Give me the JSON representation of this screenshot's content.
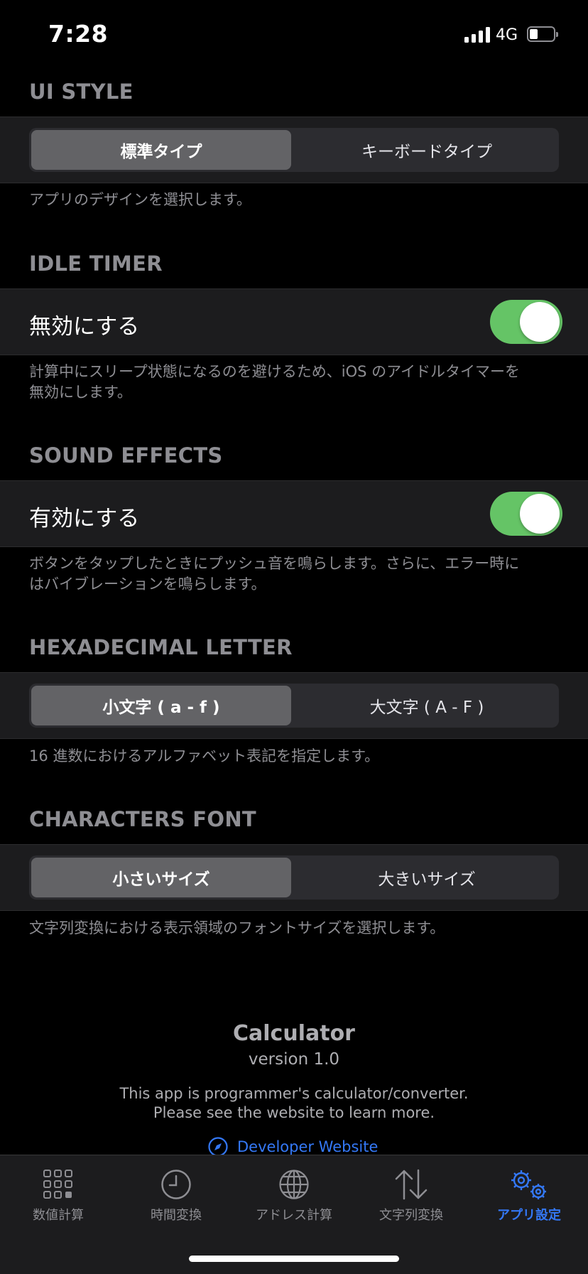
{
  "status_bar": {
    "time": "7:28",
    "network": "4G"
  },
  "ui_style": {
    "header": "UI STYLE",
    "options": [
      "標準タイプ",
      "キーボードタイプ"
    ],
    "selected": "標準タイプ",
    "footer": "アプリのデザインを選択します。"
  },
  "idle_timer": {
    "header": "IDLE TIMER",
    "label": "無効にする",
    "enabled": true,
    "footer_line1": "計算中にスリープ状態になるのを避けるため、iOS のアイドルタイマーを",
    "footer_line2": "無効にします。"
  },
  "sound_effects": {
    "header": "SOUND EFFECTS",
    "label": "有効にする",
    "enabled": true,
    "footer_line1": "ボタンをタップしたときにプッシュ音を鳴らします。さらに、エラー時に",
    "footer_line2": "はバイブレーションを鳴らします。"
  },
  "hex_letter": {
    "header": "HEXADECIMAL LETTER",
    "options": [
      "小文字 ( a - f )",
      "大文字 ( A - F )"
    ],
    "selected": "小文字 ( a - f )",
    "footer": "16 進数におけるアルファベット表記を指定します。"
  },
  "characters_font": {
    "header": "CHARACTERS FONT",
    "options": [
      "小さいサイズ",
      "大きいサイズ"
    ],
    "selected": "小さいサイズ",
    "footer": "文字列変換における表示領域のフォントサイズを選択します。"
  },
  "about": {
    "app_name": "Calculator",
    "version": "version 1.0",
    "desc_line1": "This app is programmer's calculator/converter.",
    "desc_line2": "Please see the website to learn more.",
    "link": "Developer Website"
  },
  "tabs": [
    {
      "label": "数値計算",
      "icon": "grid-icon",
      "active": false
    },
    {
      "label": "時間変換",
      "icon": "clock-icon",
      "active": false
    },
    {
      "label": "アドレス計算",
      "icon": "globe-icon",
      "active": false
    },
    {
      "label": "文字列変換",
      "icon": "arrows-updown-icon",
      "active": false
    },
    {
      "label": "アプリ設定",
      "icon": "gears-icon",
      "active": true
    }
  ],
  "colors": {
    "background": "#000000",
    "cell": "#1c1c1e",
    "toggle_on": "#65c466",
    "accent": "#3478f6",
    "secondary_text": "#8e8e93"
  }
}
